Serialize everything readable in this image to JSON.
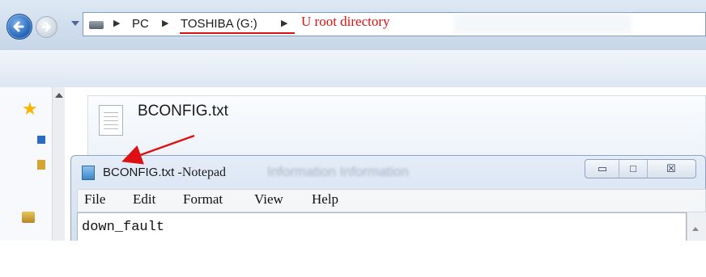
{
  "explorer": {
    "breadcrumbs": [
      "PC",
      "TOSHIBA (G:)"
    ],
    "annotation_label": "U root directory",
    "file": {
      "name": "BCONFIG.txt",
      "icon": "text-file-icon"
    },
    "nav_icons": [
      "favorites-star-icon",
      "desktop-icon",
      "folder-icon",
      "libraries-icon"
    ]
  },
  "notepad": {
    "title_file": "BCONFIG.txt",
    "title_app": "-Notepad",
    "blurred_title": "Information Information",
    "menu": [
      "File",
      "Edit",
      "Format",
      "View",
      "Help"
    ],
    "content": "down_fault",
    "window_buttons": {
      "minimize": "▭",
      "maximize": "□",
      "close": "☒"
    }
  },
  "colors": {
    "annotation": "#dd1111",
    "accent": "#1e5fb3"
  }
}
